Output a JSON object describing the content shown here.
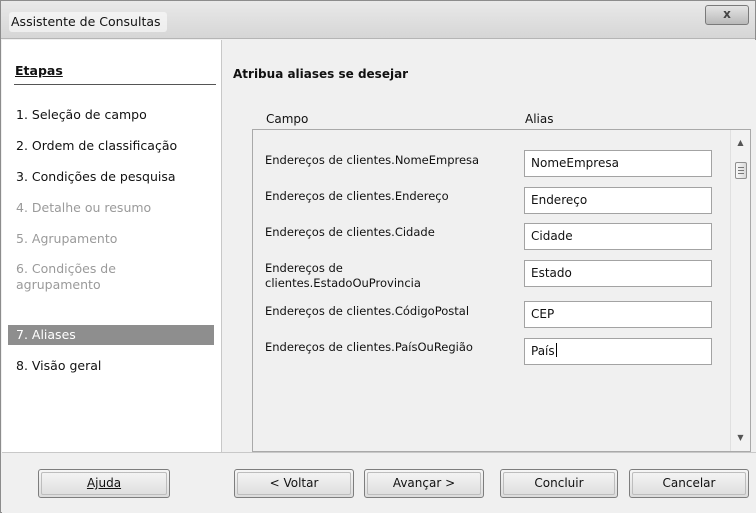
{
  "window": {
    "title": "Assistente de Consultas",
    "close_glyph": "x"
  },
  "steps": {
    "header": "Etapas",
    "items": [
      {
        "label": "1. Seleção de campo",
        "state": "enabled"
      },
      {
        "label": "2. Ordem de classificação",
        "state": "enabled"
      },
      {
        "label": "3. Condições de pesquisa",
        "state": "enabled"
      },
      {
        "label": "4. Detalhe ou resumo",
        "state": "disabled"
      },
      {
        "label": "5. Agrupamento",
        "state": "disabled"
      },
      {
        "label": "6. Condições de agrupamento",
        "state": "disabled"
      },
      {
        "label": "7. Aliases",
        "state": "active"
      },
      {
        "label": "8. Visão geral",
        "state": "enabled"
      }
    ]
  },
  "content": {
    "title": "Atribua aliases se desejar",
    "col_field": "Campo",
    "col_alias": "Alias",
    "rows": [
      {
        "field": "Endereços de clientes.NomeEmpresa",
        "alias": "NomeEmpresa"
      },
      {
        "field": "Endereços de clientes.Endereço",
        "alias": "Endereço"
      },
      {
        "field": "Endereços de clientes.Cidade",
        "alias": "Cidade"
      },
      {
        "field": "Endereços de clientes.EstadoOuProvincia",
        "alias": "Estado"
      },
      {
        "field": "Endereços de clientes.CódigoPostal",
        "alias": "CEP"
      },
      {
        "field": "Endereços de clientes.PaísOuRegião",
        "alias": "País"
      }
    ]
  },
  "buttons": {
    "help": "Ajuda",
    "back": "< Voltar",
    "next": "Avançar >",
    "finish": "Concluir",
    "cancel": "Cancelar"
  },
  "colors": {
    "active_step_bg": "#8e8e8e",
    "disabled_step_text": "#9a9a9a"
  }
}
